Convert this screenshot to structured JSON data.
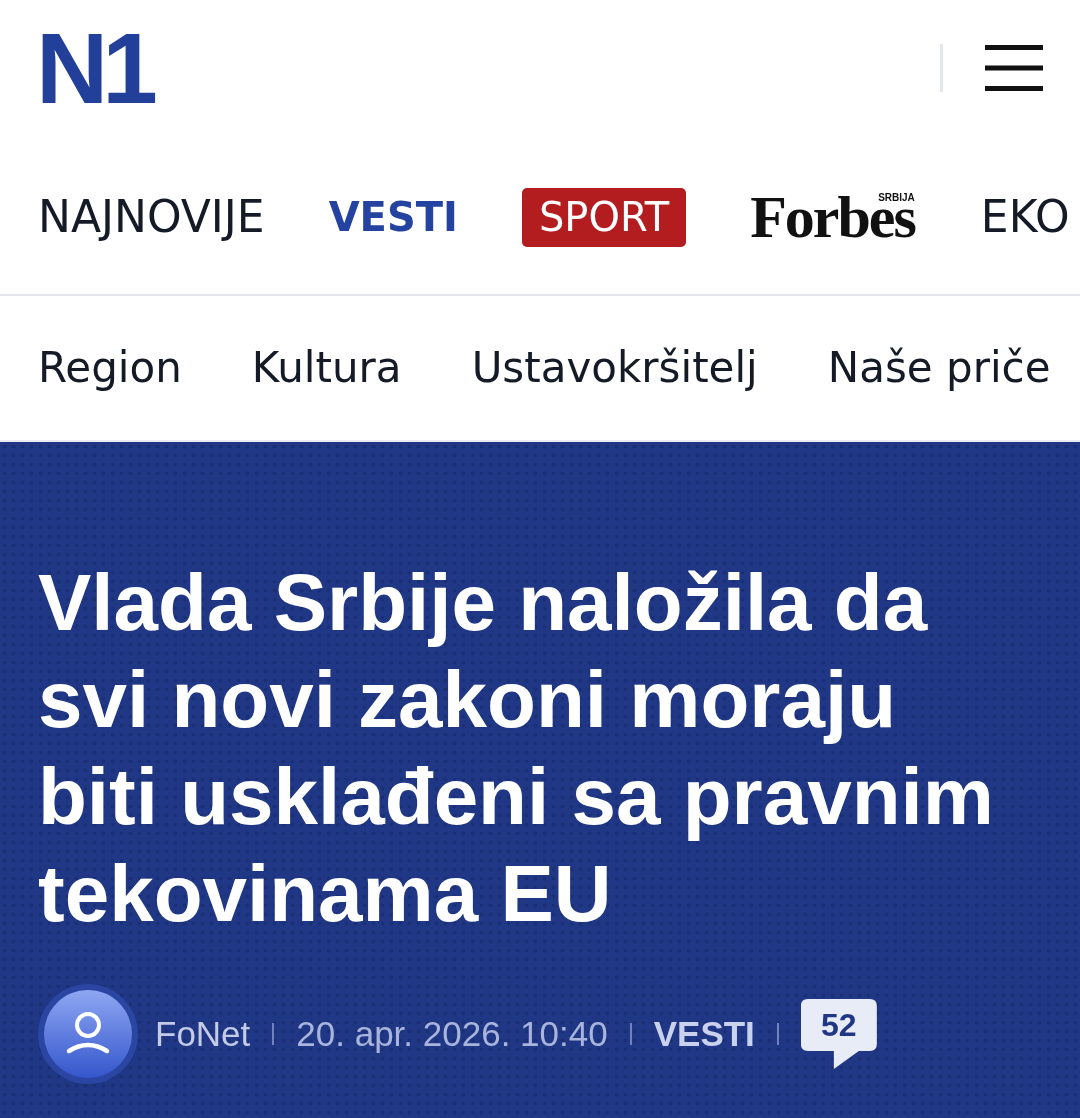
{
  "header": {
    "logo": "N1"
  },
  "main_nav": [
    {
      "label": "NAJNOVIJE",
      "kind": "plain",
      "selected": false
    },
    {
      "label": "VESTI",
      "kind": "plain",
      "selected": true
    },
    {
      "label": "SPORT",
      "kind": "boxed",
      "selected": false
    },
    {
      "label": "Forbes",
      "sublabel": "SRBIJA",
      "kind": "serif_logo",
      "selected": false
    },
    {
      "label": "EKO",
      "kind": "plain",
      "selected": false
    }
  ],
  "sub_nav": [
    {
      "label": "Region",
      "selected": false
    },
    {
      "label": "Kultura",
      "selected": false
    },
    {
      "label": "Ustavokršitelj",
      "selected": false
    },
    {
      "label": "Naše priče",
      "selected": false
    }
  ],
  "article": {
    "headline": "Vlada Srbije naložila da svi novi zakoni moraju biti usklađeni sa pravnim tekovinama EU",
    "author": "FoNet",
    "date": "20. apr. 2026. 10:40",
    "category": "VESTI",
    "comments": "52"
  }
}
